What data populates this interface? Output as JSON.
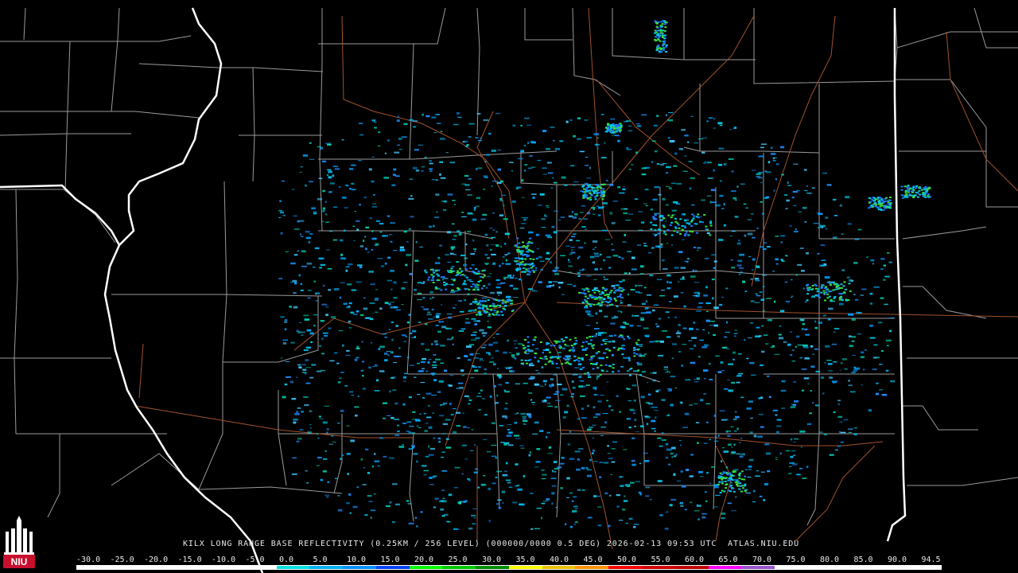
{
  "map": {
    "caption": "KILX LONG RANGE BASE REFLECTIVITY (0.25KM / 256 LEVEL) (000000/0000 0.5 DEG) 2026-02-13 09:53 UTC  ATLAS.NIU.EDU",
    "legend_labels": [
      "-30.0",
      "-25.0",
      "-20.0",
      "-15.0",
      "-10.0",
      "-5.0",
      "0.0",
      "5.0",
      "10.0",
      "15.0",
      "20.0",
      "25.0",
      "30.0",
      "35.0",
      "40.0",
      "45.0",
      "50.0",
      "55.0",
      "60.0",
      "65.0",
      "70.0",
      "75.0",
      "80.0",
      "85.0",
      "90.0",
      "94.5"
    ],
    "legend_colors": [
      "#ffffff",
      "#ffffff",
      "#ffffff",
      "#ffffff",
      "#ffffff",
      "#ffffff",
      "#00e0e0",
      "#00b0f0",
      "#0090ff",
      "#0040ff",
      "#00ff00",
      "#00c800",
      "#008c00",
      "#ffff00",
      "#e8c000",
      "#ff9000",
      "#ff0000",
      "#d00000",
      "#c00000",
      "#ff00ff",
      "#9955c9",
      "#ffffff",
      "#ffffff",
      "#ffffff",
      "#ffffff",
      "#ffffff"
    ],
    "logo_text": "NIU",
    "logo_color": "#c8102e"
  }
}
